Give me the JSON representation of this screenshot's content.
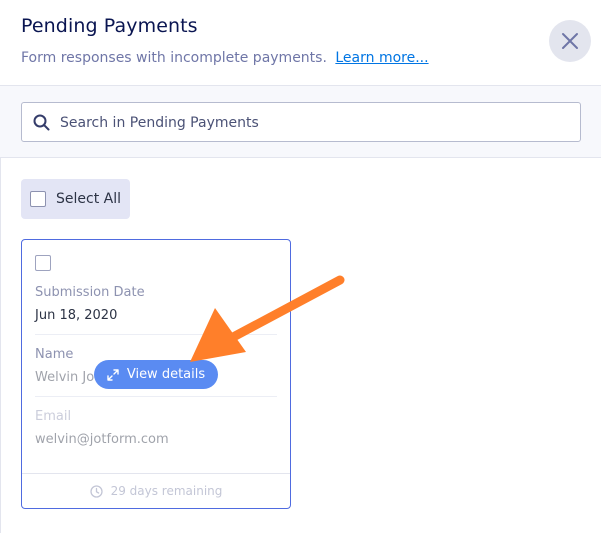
{
  "header": {
    "title": "Pending Payments",
    "subtitle": "Form responses with incomplete payments.",
    "learn_more": "Learn more..."
  },
  "close_icon": "close-icon",
  "search": {
    "icon": "search-icon",
    "placeholder": "Search in Pending Payments",
    "value": ""
  },
  "select_all": {
    "label": "Select All",
    "checked": false
  },
  "card": {
    "fields": [
      {
        "label": "Submission Date",
        "value": "Jun 18, 2020"
      },
      {
        "label": "Name",
        "value": "Welvin Jo"
      },
      {
        "label": "Email",
        "value": "welvin@jotform.com"
      }
    ],
    "footer": "29 days remaining",
    "view_details": "View details"
  },
  "colors": {
    "title": "#0a1551",
    "link": "#0075e3",
    "card_border": "#4f6be0",
    "button": "#5a8bf2",
    "annotation_arrow": "#ff7f2a"
  }
}
